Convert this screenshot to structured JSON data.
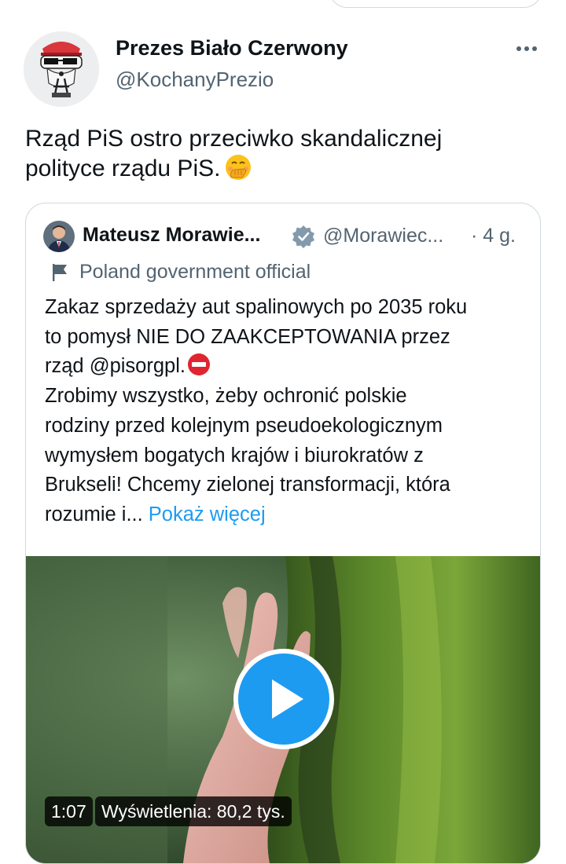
{
  "tweet": {
    "author_name": "Prezes Biało Czerwony",
    "author_handle": "@KochanyPrezio",
    "text_lines": [
      "Rząd PiS ostro przeciwko skandalicznej",
      "polityce rządu PiS."
    ],
    "emoji": "face-with-hand-over-mouth"
  },
  "quote": {
    "author_name": "Mateusz Morawie...",
    "author_handle": "@Morawiec...",
    "time": "· 4 g.",
    "label": "Poland government official",
    "text_lines": [
      "Zakaz sprzedaży aut spalinowych po 2035 roku",
      "to pomysł NIE DO ZAAKCEPTOWANIA przez",
      "rząd @pisorgpl.",
      "Zrobimy wszystko, żeby ochronić polskie",
      "rodziny przed kolejnym pseudoekologicznym",
      "wymysłem bogatych krajów i biurokratów z",
      "Brukseli! Chcemy zielonej transformacji, która",
      "rozumie i..."
    ],
    "show_more": "Pokaż więcej",
    "video": {
      "duration": "1:07",
      "views": "Wyświetlenia: 80,2 tys."
    }
  },
  "colors": {
    "accent": "#1d9bf0",
    "text": "#0f1419",
    "secondary": "#536471",
    "border": "#cfd9de"
  }
}
